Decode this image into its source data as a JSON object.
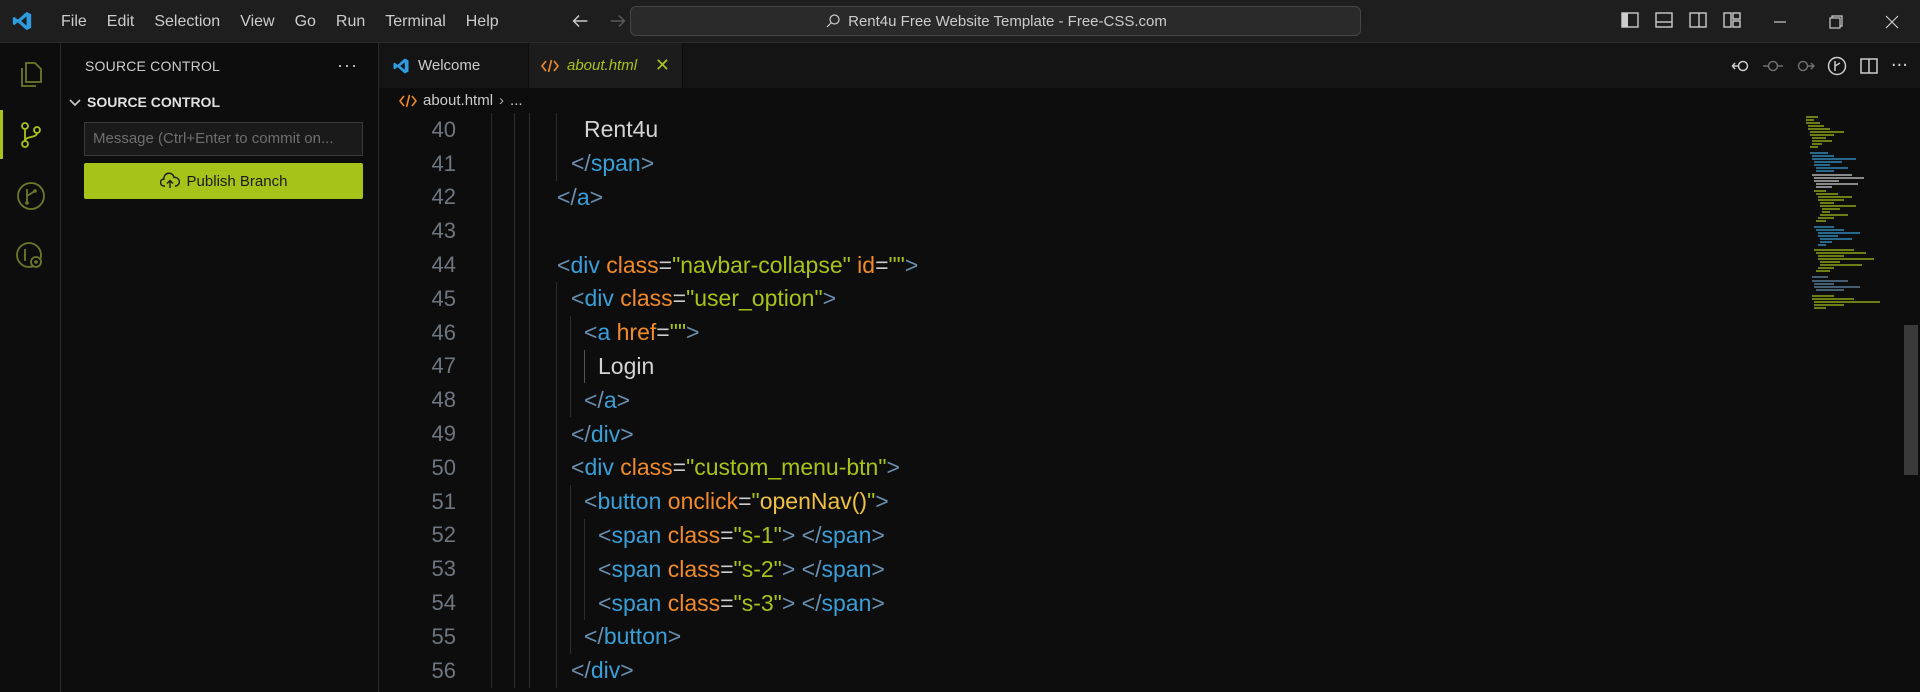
{
  "titlebar": {
    "menu": [
      "File",
      "Edit",
      "Selection",
      "View",
      "Go",
      "Run",
      "Terminal",
      "Help"
    ],
    "search_text": "Rent4u Free Website Template - Free-CSS.com"
  },
  "sidebar": {
    "title": "SOURCE CONTROL",
    "more": "···",
    "section": "SOURCE CONTROL",
    "commit_placeholder": "Message (Ctrl+Enter to commit on...",
    "publish_label": "Publish Branch"
  },
  "tabs": [
    {
      "label": "Welcome",
      "icon": "vscode-icon"
    },
    {
      "label": "about.html",
      "icon": "html-code-icon",
      "active": true
    }
  ],
  "breadcrumb": {
    "file": "about.html",
    "rest": "..."
  },
  "colors": {
    "accent": "#a6c31a",
    "tag": "#3a9fd8",
    "attr": "#f08a2a",
    "string": "#a6c31a"
  },
  "code": {
    "numbers": [
      "40",
      "41",
      "42",
      "43",
      "44",
      "45",
      "46",
      "47",
      "48",
      "49",
      "50",
      "51",
      "52",
      "53",
      "54",
      "55",
      "56"
    ],
    "l40": {
      "text": "Rent4u"
    },
    "l41": {
      "close": "</",
      "tag": "span",
      "gt": ">"
    },
    "l42": {
      "close": "</",
      "tag": "a",
      "gt": ">"
    },
    "l44": {
      "lt": "<",
      "tag": "div",
      "a1": "class",
      "v1": "\"navbar-collapse\"",
      "a2": "id",
      "v2": "\"\"",
      "gt": ">"
    },
    "l45": {
      "lt": "<",
      "tag": "div",
      "a1": "class",
      "v1": "\"user_option\"",
      "gt": ">"
    },
    "l46": {
      "lt": "<",
      "tag": "a",
      "a1": "href",
      "v1": "\"\"",
      "gt": ">"
    },
    "l47": {
      "text": "Login"
    },
    "l48": {
      "close": "</",
      "tag": "a",
      "gt": ">"
    },
    "l49": {
      "close": "</",
      "tag": "div",
      "gt": ">"
    },
    "l50": {
      "lt": "<",
      "tag": "div",
      "a1": "class",
      "v1": "\"custom_menu-btn\"",
      "gt": ">"
    },
    "l51": {
      "lt": "<",
      "tag": "button",
      "a1": "onclick",
      "q1": "\"",
      "fn": "openNav()",
      "q2": "\"",
      "gt": ">"
    },
    "l52": {
      "lt": "<",
      "tag": "span",
      "a1": "class",
      "v1": "\"s-1\"",
      "gt": ">",
      "close": " </",
      "tag2": "span",
      "gt2": ">"
    },
    "l53": {
      "lt": "<",
      "tag": "span",
      "a1": "class",
      "v1": "\"s-2\"",
      "gt": ">",
      "close": " </",
      "tag2": "span",
      "gt2": ">"
    },
    "l54": {
      "lt": "<",
      "tag": "span",
      "a1": "class",
      "v1": "\"s-3\"",
      "gt": ">",
      "close": " </",
      "tag2": "span",
      "gt2": ">"
    },
    "l55": {
      "close": "</",
      "tag": "button",
      "gt": ">"
    },
    "l56": {
      "close": "</",
      "tag": "div",
      "gt": ">"
    }
  }
}
